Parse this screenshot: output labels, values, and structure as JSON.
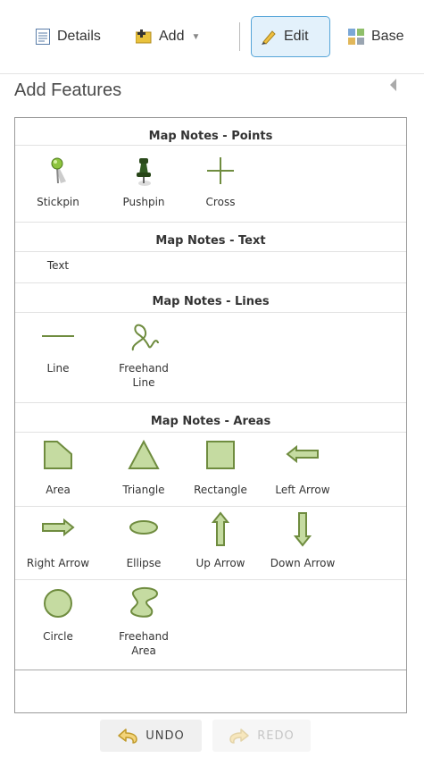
{
  "toolbar": {
    "details_label": "Details",
    "add_label": "Add",
    "edit_label": "Edit",
    "basemap_label": "Base"
  },
  "panel": {
    "title": "Add Features"
  },
  "sections": {
    "points": {
      "header": "Map Notes - Points",
      "items": [
        "Stickpin",
        "Pushpin",
        "Cross"
      ]
    },
    "text": {
      "header": "Map Notes - Text",
      "items": [
        "Text"
      ]
    },
    "lines": {
      "header": "Map Notes - Lines",
      "items": [
        "Line",
        "Freehand\nLine"
      ]
    },
    "areas": {
      "header": "Map Notes - Areas",
      "items": [
        "Area",
        "Triangle",
        "Rectangle",
        "Left Arrow",
        "Right Arrow",
        "Ellipse",
        "Up Arrow",
        "Down Arrow",
        "Circle",
        "Freehand\nArea"
      ]
    }
  },
  "actions": {
    "undo_label": "UNDO",
    "redo_label": "REDO"
  },
  "colors": {
    "shape_fill": "#c5dba1",
    "shape_stroke": "#6f8c3f",
    "edit_active_bg": "#e3f1fb",
    "edit_active_border": "#56a5d8"
  }
}
